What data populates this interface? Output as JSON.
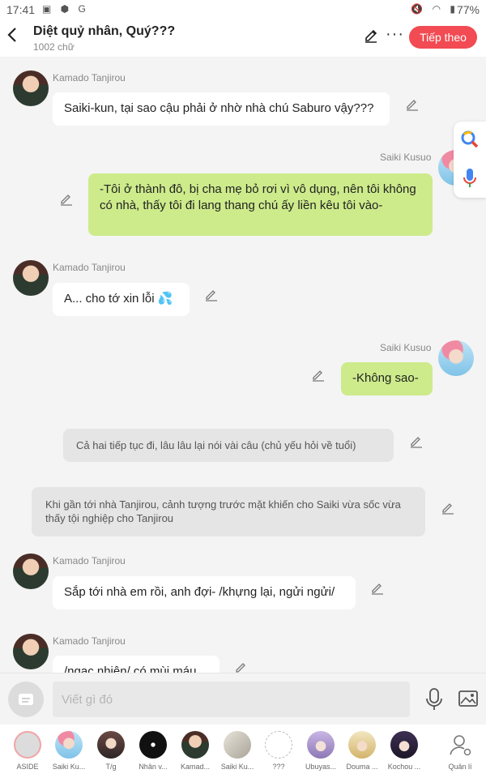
{
  "status": {
    "time": "17:41",
    "battery": "77%"
  },
  "header": {
    "title": "Diệt quỷ nhân, Quý???",
    "word_count": "1002 chữ",
    "follow_label": "Tiếp theo",
    "follow_color": "#f24b53"
  },
  "messages": [
    {
      "sender": "Kamado Tanjirou",
      "side": "left",
      "text": "Saiki-kun, tại sao cậu phải ở nhờ nhà chú Saburo vậy???"
    },
    {
      "sender": "Saiki Kusuo",
      "side": "right",
      "text": "-Tôi ở thành đô, bị cha mẹ bỏ rơi vì vô dụng, nên tôi không có nhà, thấy tôi đi lang thang chú ấy liền kêu tôi vào-"
    },
    {
      "sender": "Kamado Tanjirou",
      "side": "left",
      "text": "A... cho tớ xin lỗi 💦"
    },
    {
      "sender": "Saiki Kusuo",
      "side": "right",
      "text": "-Không sao-"
    },
    {
      "type": "narration",
      "text": "Cả hai tiếp tục đi, lâu lâu lại nói vài câu (chủ yếu hỏi về tuổi)"
    },
    {
      "type": "narration",
      "text": "Khi gần tới nhà Tanjirou, cảnh tượng trước mặt khiến cho Saiki vừa sốc vừa thấy tội nghiệp cho Tanjirou"
    },
    {
      "sender": "Kamado Tanjirou",
      "side": "left",
      "text": "Sắp tới nhà em rồi, anh đợi- /khựng lại, ngửi ngửi/"
    },
    {
      "sender": "Kamado Tanjirou",
      "side": "left",
      "text": "/ngạc nhiên/ có mùi máu"
    }
  ],
  "input": {
    "placeholder": "Viết gì đó"
  },
  "characters": [
    {
      "name": "ASIDE"
    },
    {
      "name": "Saiki Ku..."
    },
    {
      "name": "T/g"
    },
    {
      "name": "Nhân v..."
    },
    {
      "name": "Kamad..."
    },
    {
      "name": "Saiki Ku..."
    },
    {
      "name": "???"
    },
    {
      "name": "Ubuyas..."
    },
    {
      "name": "Douma ..."
    },
    {
      "name": "Kochou ..."
    },
    {
      "name": "Quản lí"
    }
  ],
  "colors": {
    "green_bubble": "#cdeb8b",
    "accent_red": "#f24b53"
  }
}
